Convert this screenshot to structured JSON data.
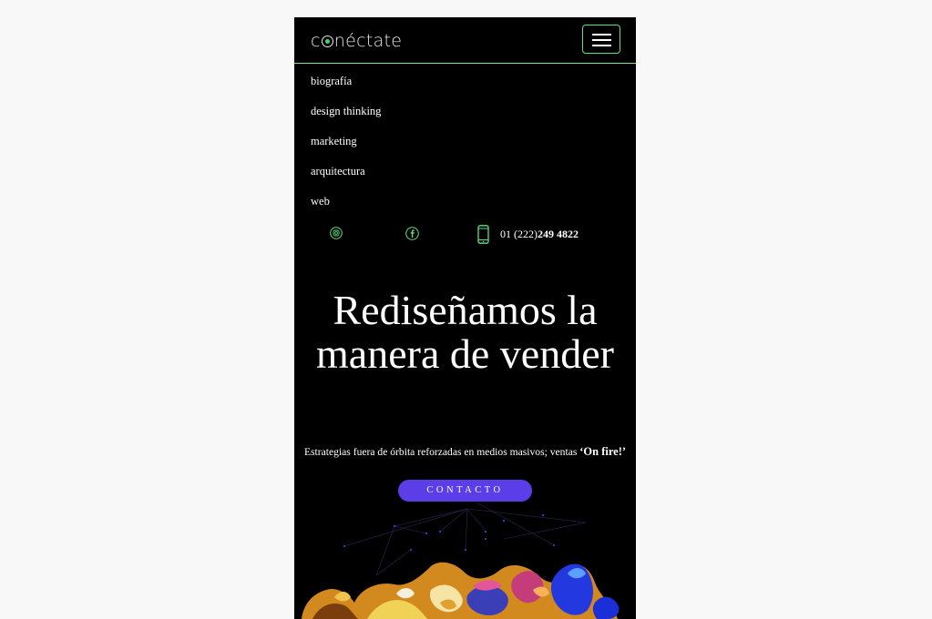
{
  "header": {
    "logo_pre": "c",
    "logo_post": "néctate"
  },
  "nav": {
    "items": [
      {
        "label": "biografía"
      },
      {
        "label": "design thinking"
      },
      {
        "label": "marketing"
      },
      {
        "label": "arquitectura"
      },
      {
        "label": "web"
      }
    ]
  },
  "contact": {
    "phone_prefix": "01 (222)",
    "phone_number": "249 4822",
    "icons": [
      "instagram-icon",
      "facebook-icon",
      "mobile-phone-icon"
    ]
  },
  "hero": {
    "title": "Rediseñamos la manera de vender",
    "tagline_text": "Estrategias fuera de órbita reforzadas en medios masivos; ventas ",
    "tagline_emphasis": "‘On fire!’",
    "cta_label": "CONTACTO"
  },
  "colors": {
    "accent_green": "#5fe07c",
    "cta_purple": "#5b3ee8",
    "background": "#000000"
  }
}
